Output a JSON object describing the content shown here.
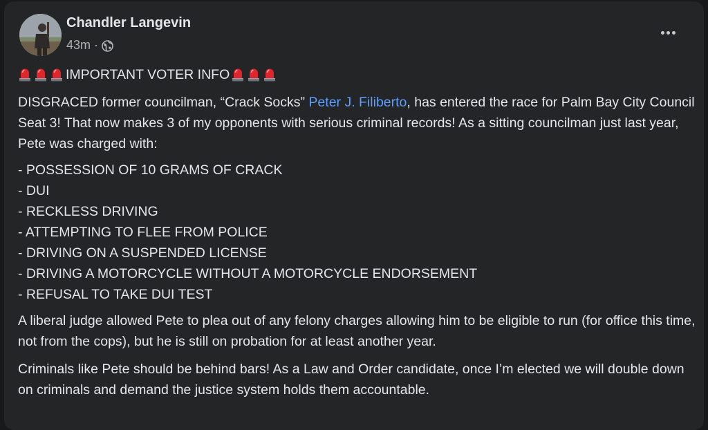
{
  "post": {
    "author": "Chandler Langevin",
    "time": "43m",
    "separator": "·",
    "privacy_icon": "globe-icon",
    "more_icon": "more-options-icon",
    "headline_icon": "police-light-siren-icon",
    "headline": "IMPORTANT VOTER INFO",
    "para1_before": "DISGRACED former councilman, “Crack Socks” ",
    "mention": "Peter J. Filiberto",
    "para1_after": ", has entered the race for Palm Bay City Council Seat 3! That now makes 3 of my opponents with serious criminal records! As a sitting councilman just last year, Pete was charged with:",
    "charges": [
      "- POSSESSION OF 10 GRAMS OF CRACK",
      "- DUI",
      "- RECKLESS DRIVING",
      "- ATTEMPTING TO FLEE FROM POLICE",
      "- DRIVING ON A SUSPENDED LICENSE",
      "- DRIVING A MOTORCYCLE WITHOUT A MOTORCYCLE ENDORSEMENT",
      "- REFUSAL TO TAKE DUI TEST"
    ],
    "para2": "A liberal judge allowed Pete to plea out of any felony charges allowing him to be eligible to run (for office this time, not from the cops), but he is still on probation for at least another year.",
    "para3": "Criminals like Pete should be behind bars! As a Law and Order candidate, once I’m elected we will double down on criminals and demand the justice system holds them accountable."
  },
  "colors": {
    "page_bg": "#18191a",
    "card_bg": "#242526",
    "text": "#e4e6eb",
    "secondary_text": "#b0b3b8",
    "link": "#5b9fff",
    "siren_red": "#e0262c"
  }
}
